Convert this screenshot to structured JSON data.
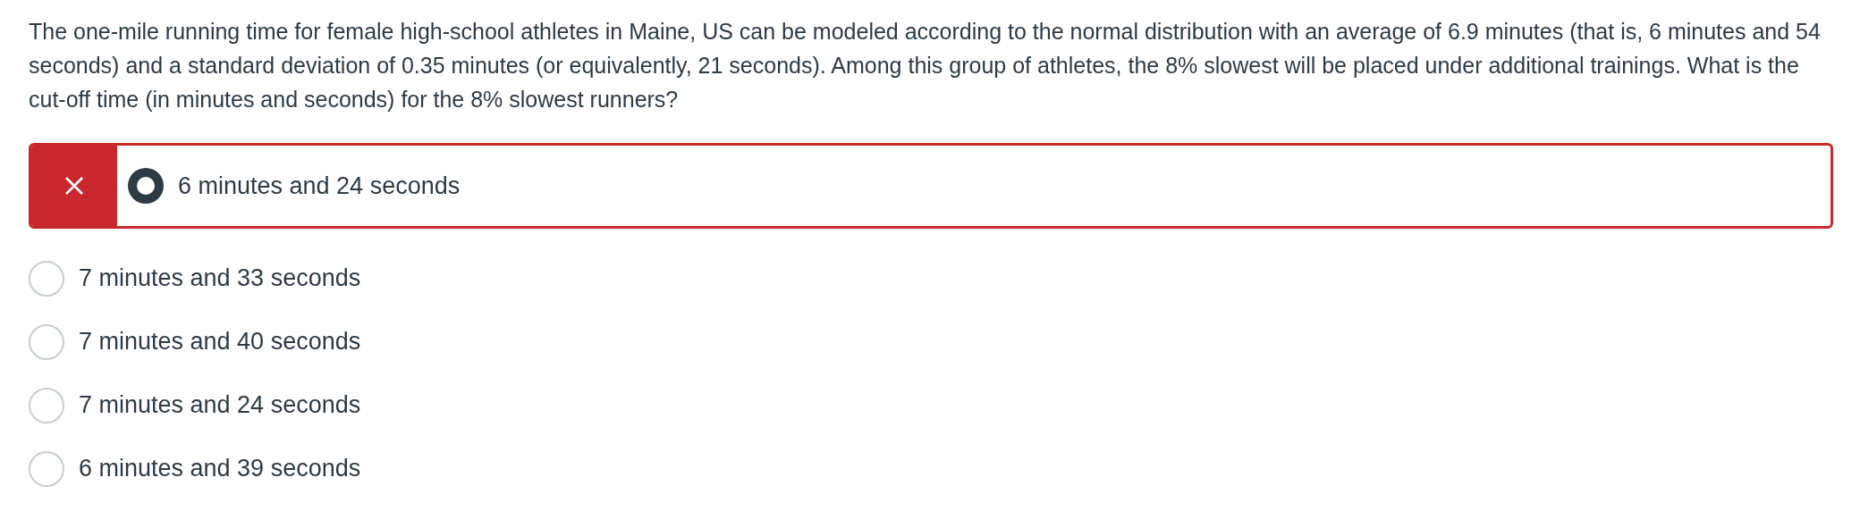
{
  "question": "The one-mile running time for female high-school athletes in Maine, US can be modeled according to the normal distribution with an average of 6.9 minutes (that is,  6 minutes and 54 seconds)  and a standard deviation of 0.35 minutes (or equivalently, 21 seconds). Among this group of athletes, the 8% slowest will be placed under additional trainings. What is the cut-off time (in minutes and seconds) for the 8% slowest runners?",
  "answers": [
    {
      "label": "6 minutes and 24 seconds",
      "selected": true,
      "marked_incorrect": true
    },
    {
      "label": "7 minutes and 33 seconds",
      "selected": false,
      "marked_incorrect": false
    },
    {
      "label": "7 minutes and 40 seconds",
      "selected": false,
      "marked_incorrect": false
    },
    {
      "label": "7 minutes and 24 seconds",
      "selected": false,
      "marked_incorrect": false
    },
    {
      "label": "6 minutes and 39 seconds",
      "selected": false,
      "marked_incorrect": false
    }
  ]
}
